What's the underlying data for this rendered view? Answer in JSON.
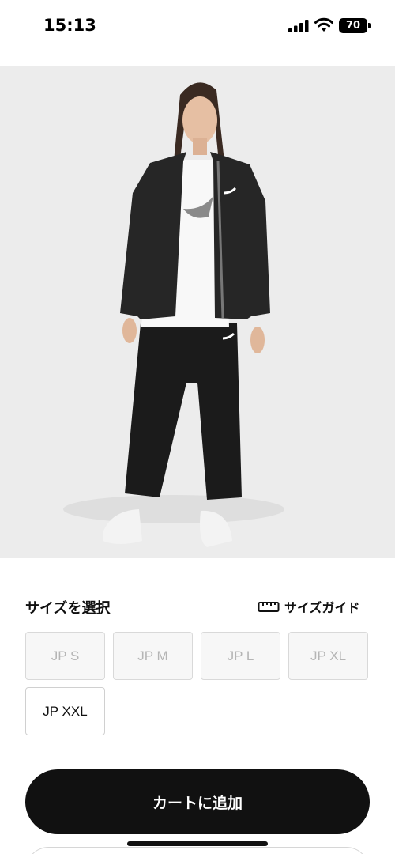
{
  "status": {
    "time": "15:13",
    "battery": "70"
  },
  "carousel": {
    "total": 5,
    "active_index": 4
  },
  "size_section": {
    "title": "サイズを選択",
    "guide_label": "サイズガイド",
    "sizes": [
      {
        "label": "JP S",
        "available": false
      },
      {
        "label": "JP M",
        "available": false
      },
      {
        "label": "JP L",
        "available": false
      },
      {
        "label": "JP XL",
        "available": false
      },
      {
        "label": "JP XXL",
        "available": true
      }
    ]
  },
  "actions": {
    "add_to_cart": "カートに追加"
  },
  "colors": {
    "button_bg": "#111111",
    "image_bg": "#ececec",
    "disabled_text": "#b5b5b5"
  }
}
